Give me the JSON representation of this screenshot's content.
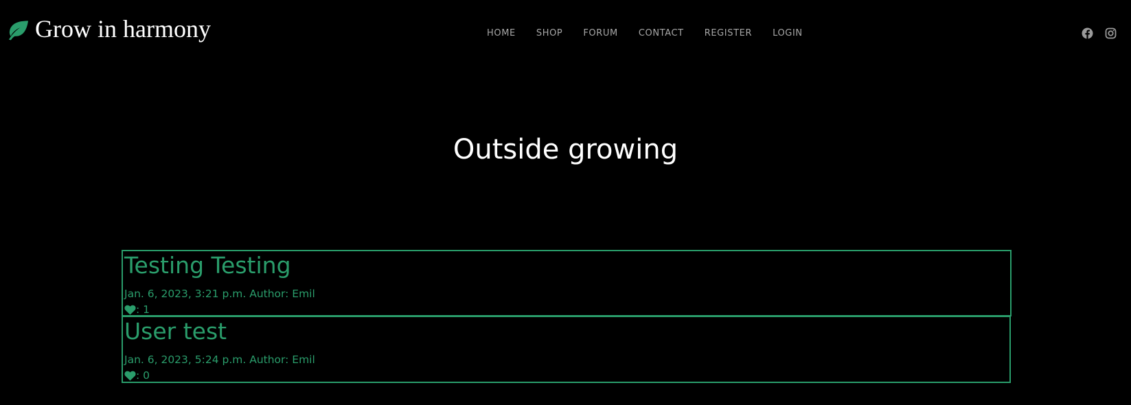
{
  "brand": {
    "name": "Grow in harmony",
    "icon": "leaf-icon",
    "accent": "#2a9d6b"
  },
  "nav": {
    "items": [
      {
        "label": "HOME"
      },
      {
        "label": "SHOP"
      },
      {
        "label": "FORUM"
      },
      {
        "label": "CONTACT"
      },
      {
        "label": "REGISTER"
      },
      {
        "label": "LOGIN"
      }
    ]
  },
  "social": {
    "icons": [
      "facebook-icon",
      "instagram-icon"
    ]
  },
  "page": {
    "title": "Outside growing"
  },
  "posts": [
    {
      "title": "Testing Testing",
      "meta": "Jan. 6, 2023, 3:21 p.m. Author: Emil",
      "likes": ": 1"
    },
    {
      "title": "User test",
      "meta": "Jan. 6, 2023, 5:24 p.m. Author: Emil",
      "likes": ": 0"
    }
  ],
  "colors": {
    "background": "#000000",
    "accent": "#2a9d6b",
    "nav_text": "#a7a7a7"
  }
}
